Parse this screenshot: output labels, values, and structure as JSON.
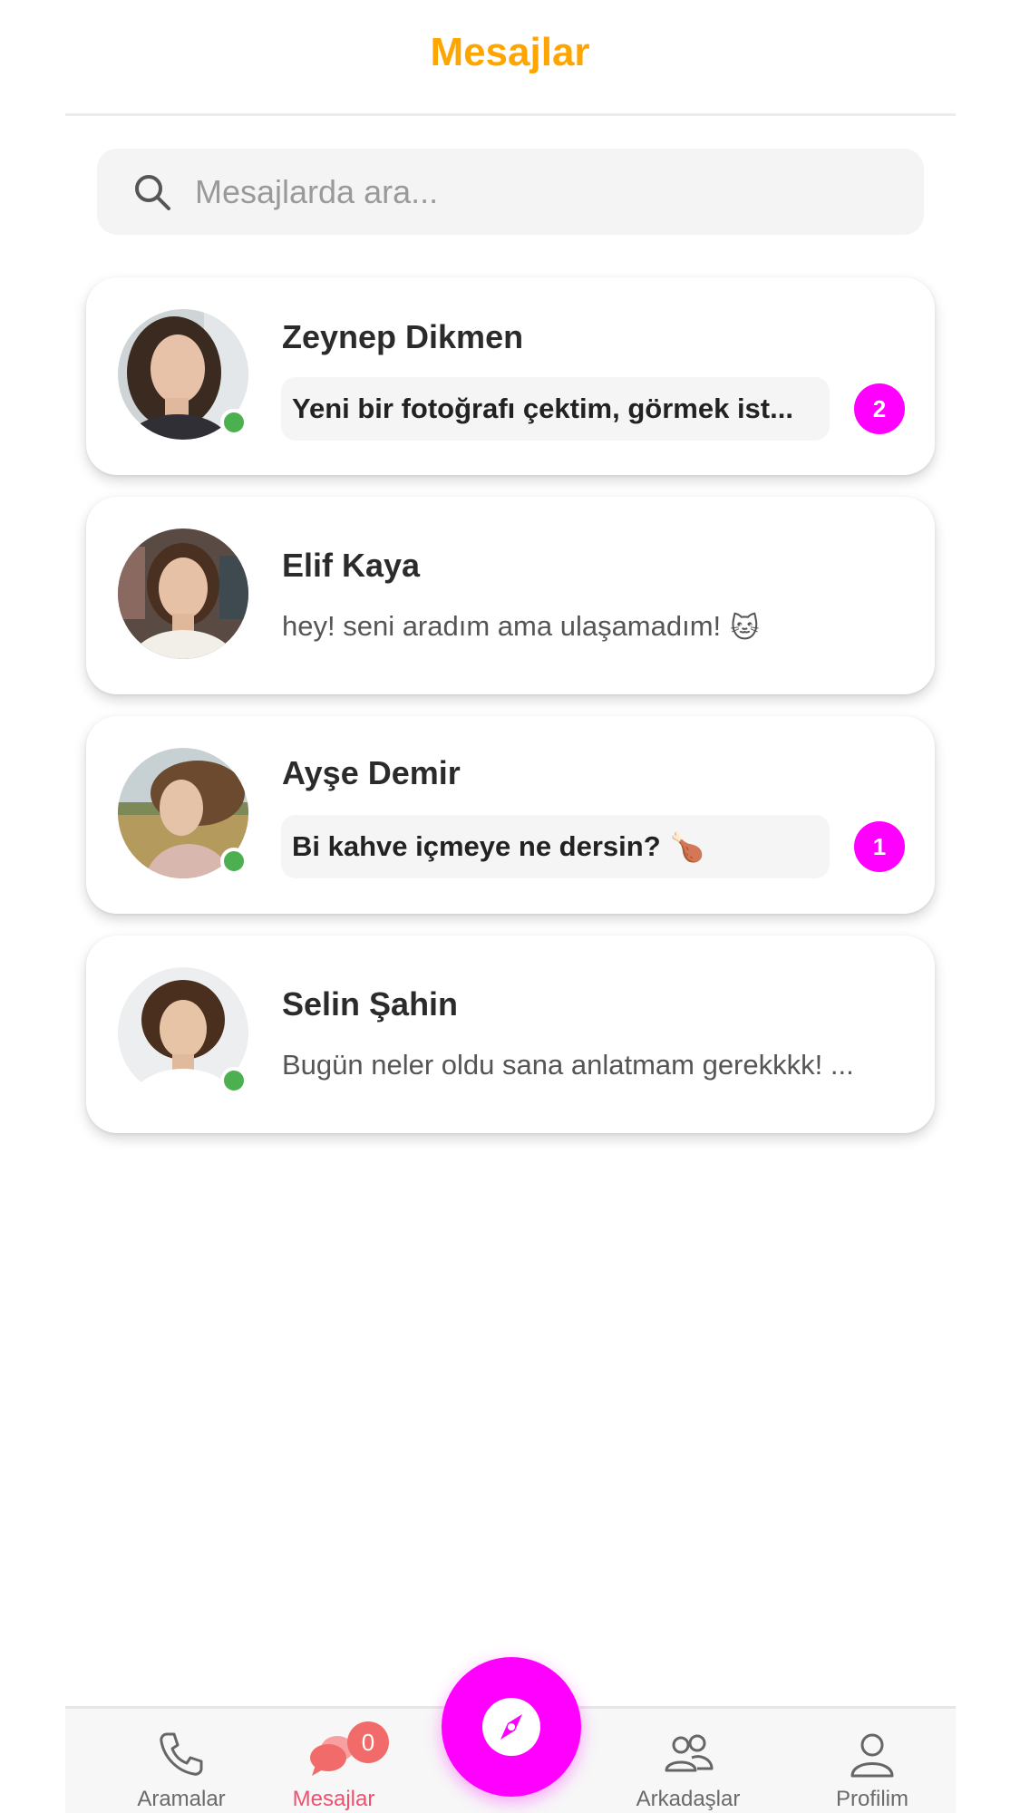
{
  "header": {
    "title": "Mesajlar"
  },
  "search": {
    "placeholder": "Mesajlarda ara..."
  },
  "conversations": [
    {
      "name": "Zeynep Dikmen",
      "message": "Yeni bir fotoğrafı çektim, görmek ist...",
      "unread": "2",
      "online": true,
      "emoji": ""
    },
    {
      "name": "Elif Kaya",
      "message": "hey! seni aradım ama ulaşamadım!",
      "unread": "",
      "online": false,
      "emoji": "🐱"
    },
    {
      "name": "Ayşe Demir",
      "message": "Bi kahve içmeye ne dersin?",
      "unread": "1",
      "online": true,
      "emoji": "🍗"
    },
    {
      "name": "Selin Şahin",
      "message": "Bugün neler oldu sana anlatmam gerekkkk! ...",
      "unread": "",
      "online": true,
      "emoji": ""
    }
  ],
  "nav": {
    "calls": "Aramalar",
    "messages": "Mesajlar",
    "messages_badge": "0",
    "friends": "Arkadaşlar",
    "profile": "Profilim"
  },
  "colors": {
    "accent": "#ffa500",
    "unread_badge": "#ff00ff",
    "online": "#4caf50",
    "active_nav": "#f0506e",
    "fab": "#ff00ff"
  },
  "icons": {
    "search": "search-icon",
    "calls": "phone-icon",
    "messages": "chat-bubbles-icon",
    "fab": "compass-icon",
    "friends": "users-icon",
    "profile": "user-icon"
  }
}
